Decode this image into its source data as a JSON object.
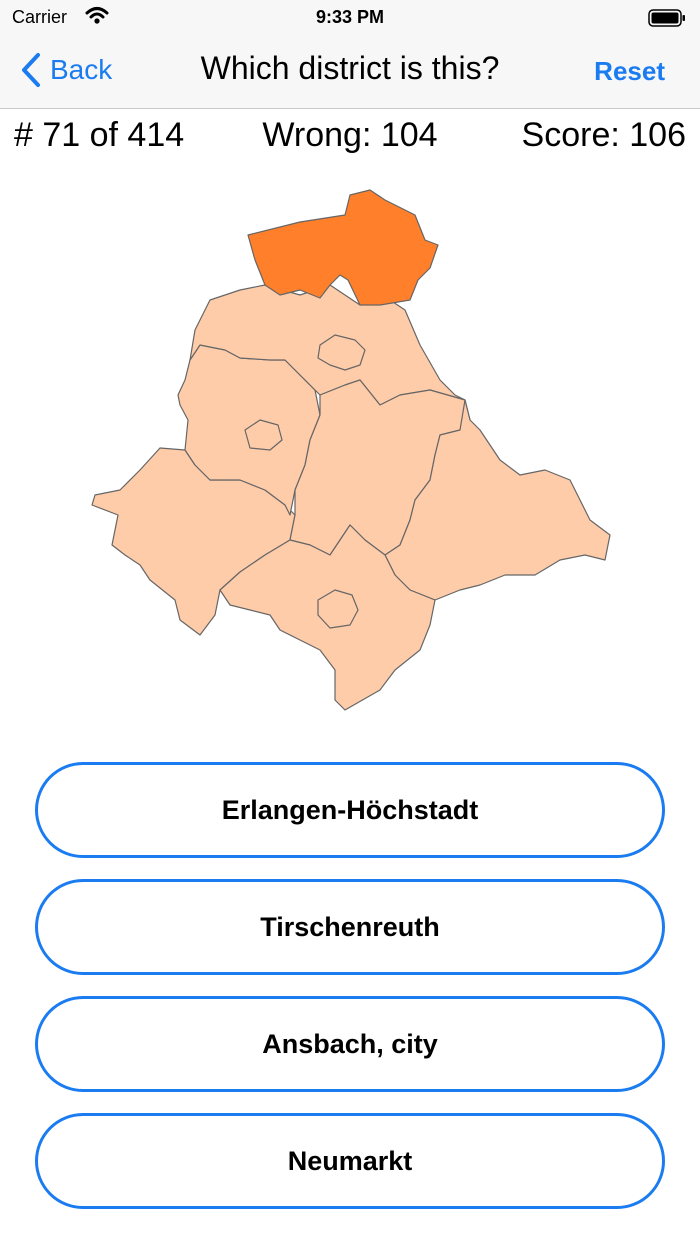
{
  "status_bar": {
    "carrier": "Carrier",
    "time": "9:33 PM"
  },
  "nav": {
    "back_label": "Back",
    "title": "Which district is this?",
    "reset_label": "Reset"
  },
  "stats": {
    "question_counter": "# 71 of 414",
    "wrong": "Wrong: 104",
    "score": "Score: 106"
  },
  "map": {
    "highlight_color": "#ff7f2a",
    "base_color": "#ffccaa",
    "border_color": "#666666"
  },
  "answers": [
    {
      "label": "Erlangen-Höchstadt"
    },
    {
      "label": "Tirschenreuth"
    },
    {
      "label": "Ansbach, city"
    },
    {
      "label": "Neumarkt"
    }
  ]
}
